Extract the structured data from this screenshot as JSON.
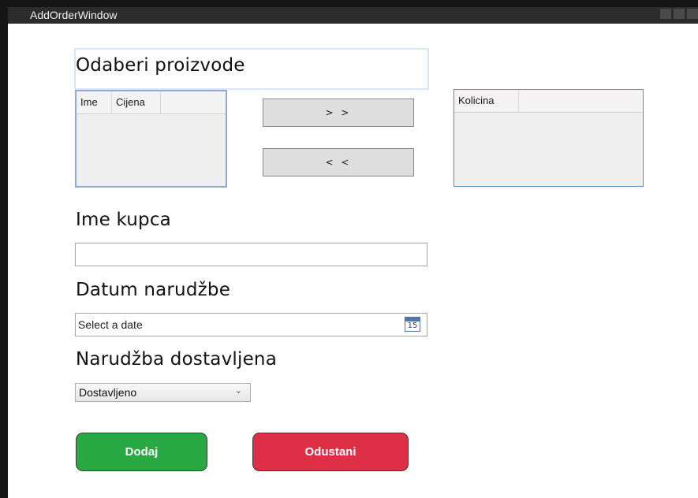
{
  "window": {
    "title": "AddOrderWindow"
  },
  "products_section": {
    "heading": "Odaberi proizvode",
    "products_grid": {
      "columns": [
        "Ime",
        "Cijena"
      ]
    },
    "add_button_label": "> >",
    "remove_button_label": "< <",
    "quantity_grid": {
      "columns": [
        "Kolicina"
      ]
    }
  },
  "customer": {
    "heading": "Ime kupca",
    "value": ""
  },
  "order_date": {
    "heading": "Datum narudžbe",
    "placeholder": "Select a date",
    "calendar_icon_text": "15",
    "icon": "calendar-icon"
  },
  "delivery": {
    "heading": "Narudžba dostavljena",
    "selected": "Dostavljeno",
    "icon": "chevron-down-icon"
  },
  "actions": {
    "add_label": "Dodaj",
    "cancel_label": "Odustani",
    "add_color": "#29a944",
    "cancel_color": "#dd3047"
  }
}
